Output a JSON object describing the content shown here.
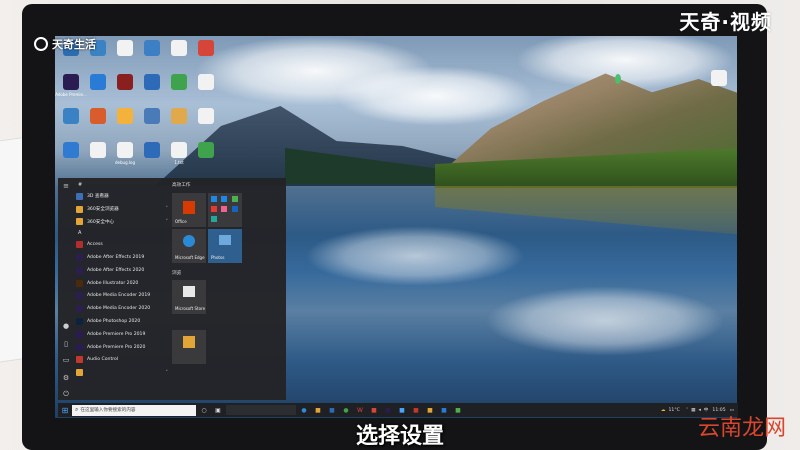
{
  "brand": "天奇·视频",
  "watermark_top_left": "天奇生活",
  "watermark_bottom_right": "云南龙网",
  "caption": "选择设置",
  "desktop": {
    "icons": [
      {
        "label": "",
        "color": "#2b6cb0"
      },
      {
        "label": "",
        "color": "#3b82c4"
      },
      {
        "label": "",
        "color": "#f2f2f2"
      },
      {
        "label": "",
        "color": "#3d7fc5"
      },
      {
        "label": "",
        "color": "#f2f2f2"
      },
      {
        "label": "",
        "color": "#d6453a"
      },
      {
        "label": "Adobe Premie...",
        "color": "#2b1b53"
      },
      {
        "label": "",
        "color": "#2a7bd6"
      },
      {
        "label": "",
        "color": "#8a1f1f"
      },
      {
        "label": "",
        "color": "#2d6bb8"
      },
      {
        "label": "",
        "color": "#3fa34d"
      },
      {
        "label": "",
        "color": "#f2f2f2"
      },
      {
        "label": "",
        "color": "#3b82c4"
      },
      {
        "label": "",
        "color": "#d85c2c"
      },
      {
        "label": "",
        "color": "#f3b23b"
      },
      {
        "label": "",
        "color": "#4a7ab8"
      },
      {
        "label": "",
        "color": "#e0a94b"
      },
      {
        "label": "",
        "color": "#f2f2f2"
      },
      {
        "label": "",
        "color": "#2f7bd1"
      },
      {
        "label": "",
        "color": "#f2f2f2"
      },
      {
        "label": "debug.log",
        "color": "#f2f2f2"
      },
      {
        "label": "",
        "color": "#2d6bb8"
      },
      {
        "label": "1.txt",
        "color": "#f2f2f2"
      },
      {
        "label": "",
        "color": "#3fa34d"
      }
    ],
    "right_icon_label": ""
  },
  "start_menu": {
    "letter_header_hash": "#",
    "list": [
      {
        "label": "3D 查看器",
        "color": "#3b6fb6",
        "chevron": false
      },
      {
        "label": "360安全浏览器",
        "color": "#e3a537",
        "chevron": true
      },
      {
        "label": "360安全中心",
        "color": "#e3a537",
        "chevron": true
      }
    ],
    "letter_header_a": "A",
    "apps": [
      {
        "label": "Access",
        "color": "#b22d2d",
        "chevron": false
      },
      {
        "label": "Adobe After Effects 2019",
        "color": "#2a1f4f",
        "chevron": false
      },
      {
        "label": "Adobe After Effects 2020",
        "color": "#2a1f4f",
        "chevron": false
      },
      {
        "label": "Adobe Illustrator 2020",
        "color": "#4b2a0a",
        "chevron": false
      },
      {
        "label": "Adobe Media Encoder 2019",
        "color": "#2a1f4f",
        "chevron": false
      },
      {
        "label": "Adobe Media Encoder 2020",
        "color": "#2a1f4f",
        "chevron": false
      },
      {
        "label": "Adobe Photoshop 2020",
        "color": "#0c2340",
        "chevron": false
      },
      {
        "label": "Adobe Premiere Pro 2019",
        "color": "#2b1b53",
        "chevron": false
      },
      {
        "label": "Adobe Premiere Pro 2020",
        "color": "#2b1b53",
        "chevron": false
      },
      {
        "label": "Audio Control",
        "color": "#c2382b",
        "chevron": false
      },
      {
        "label": "",
        "color": "#e3a537",
        "chevron": true
      }
    ],
    "tiles_group_1": "高效工作",
    "tiles_group_2": "浏览",
    "tiles": {
      "office": "Office",
      "edge": "Microsoft Edge",
      "photos": "Photos",
      "store": "Microsoft Store",
      "app5": ""
    }
  },
  "taskbar": {
    "search_placeholder": "在这里输入你要搜索的内容",
    "weather": "11°C",
    "time": "11:05",
    "date": ""
  }
}
